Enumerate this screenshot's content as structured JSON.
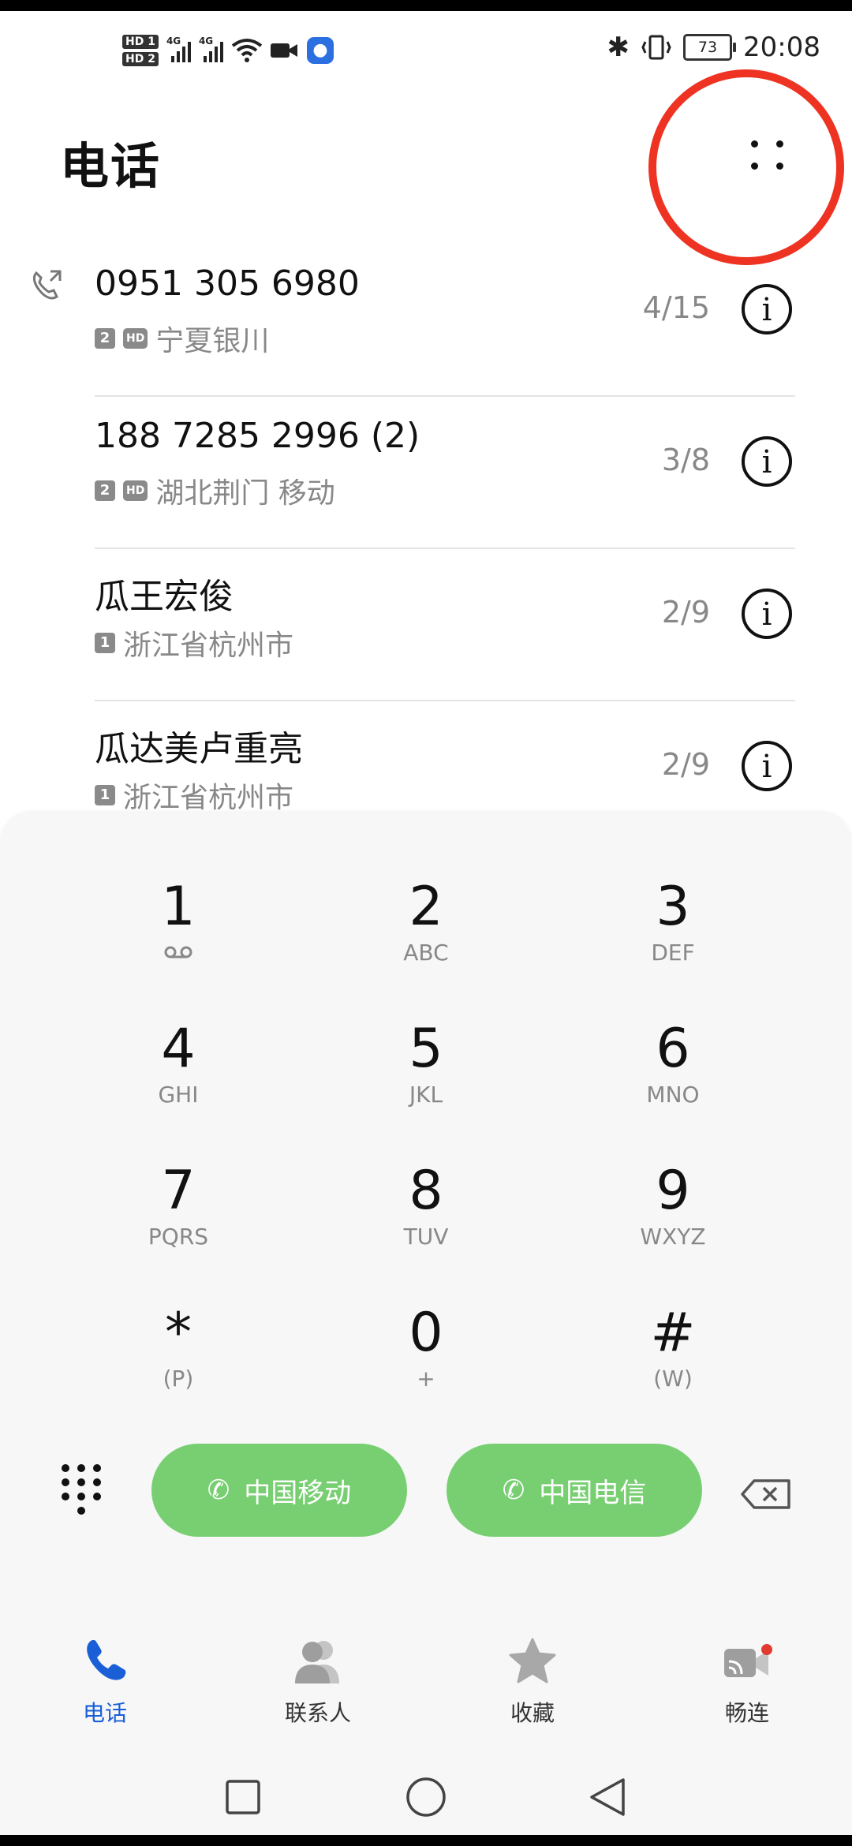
{
  "status_bar": {
    "hd1": "HD 1",
    "hd2": "HD 2",
    "net1": "4G",
    "net2": "4G",
    "battery": "73",
    "time": "20:08"
  },
  "header": {
    "title": "电话"
  },
  "calls": [
    {
      "name": "0951 305 6980",
      "sim": "2",
      "hd": "HD",
      "location": "宁夏银川",
      "date": "4/15"
    },
    {
      "name": "188 7285 2996 (2)",
      "sim": "2",
      "hd": "HD",
      "location": "湖北荆门 移动",
      "date": "3/8"
    },
    {
      "name": "瓜王宏俊",
      "sim": "1",
      "hd": "",
      "location": "浙江省杭州市",
      "date": "2/9"
    },
    {
      "name": "瓜达美卢重亮",
      "sim": "1",
      "hd": "",
      "location": "浙江省杭州市",
      "date": "2/9"
    }
  ],
  "dialpad": {
    "keys": [
      {
        "digit": "1",
        "letters": ""
      },
      {
        "digit": "2",
        "letters": "ABC"
      },
      {
        "digit": "3",
        "letters": "DEF"
      },
      {
        "digit": "4",
        "letters": "GHI"
      },
      {
        "digit": "5",
        "letters": "JKL"
      },
      {
        "digit": "6",
        "letters": "MNO"
      },
      {
        "digit": "7",
        "letters": "PQRS"
      },
      {
        "digit": "8",
        "letters": "TUV"
      },
      {
        "digit": "9",
        "letters": "WXYZ"
      },
      {
        "digit": "*",
        "letters": "(P)"
      },
      {
        "digit": "0",
        "letters": "+"
      },
      {
        "digit": "#",
        "letters": "(W)"
      }
    ],
    "sim1_label": "中国移动",
    "sim2_label": "中国电信",
    "call_color": "#78cf72"
  },
  "tabs": [
    {
      "label": "电话",
      "icon": "phone-icon",
      "active": true
    },
    {
      "label": "联系人",
      "icon": "contacts-icon",
      "active": false
    },
    {
      "label": "收藏",
      "icon": "star-icon",
      "active": false
    },
    {
      "label": "畅连",
      "icon": "meetime-icon",
      "active": false
    }
  ],
  "accent": "#1a5fd6"
}
